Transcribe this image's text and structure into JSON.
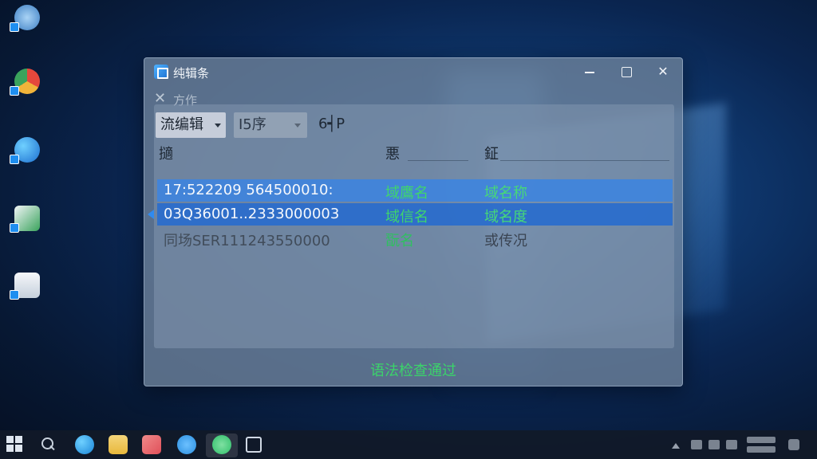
{
  "colors": {
    "accent": "#2c6cd0",
    "status_green": "#3bd46a",
    "window_bg": "#70849c"
  },
  "desktop": {
    "icons": [
      {
        "icon": "recycle-bin-icon",
        "color": "#7fb6e8"
      },
      {
        "icon": "chrome-icon",
        "color": "#f1b43a"
      },
      {
        "icon": "edge-icon",
        "color": "#1c8de0"
      },
      {
        "icon": "document-app-icon",
        "color": "#3aa35c"
      },
      {
        "icon": "file-icon",
        "color": "#d6dde8"
      }
    ]
  },
  "window": {
    "title": "纯辑条",
    "minimize_icon": "minimize-icon",
    "maximize_icon": "maximize-icon",
    "close_glyph": "✕",
    "action": {
      "glyph": "✕",
      "label": "方作"
    },
    "toolbar": {
      "mode_select": "流编辑",
      "size_select": "I5序",
      "meta": "6┥P"
    },
    "table": {
      "headers": [
        "擿",
        "悪",
        "鉦"
      ],
      "rows": [
        {
          "c1": "17:522209  564500010:",
          "c2": "域鷹名",
          "c3": "域名称",
          "state": "selected-light"
        },
        {
          "c1": "03Q36001..2333000003",
          "c2": "域信名",
          "c3": "域名度",
          "state": "selected"
        },
        {
          "c1": "同场SER111243550000",
          "c2": "翫名",
          "c3": "或传况",
          "state": "plain"
        }
      ]
    },
    "status": "语法检查通过"
  },
  "taskbar": {
    "apps": [
      {
        "icon": "edge-icon",
        "color": "#1a86d8"
      },
      {
        "icon": "file-explorer-icon",
        "color": "#e8b83c"
      },
      {
        "icon": "media-app-icon",
        "color": "#e0505a"
      },
      {
        "icon": "cloud-app-icon",
        "color": "#2b8fe0"
      },
      {
        "icon": "chat-app-icon",
        "color": "#2fbf6a"
      },
      {
        "icon": "task-view-icon",
        "color": "#d0d8e4"
      }
    ]
  }
}
